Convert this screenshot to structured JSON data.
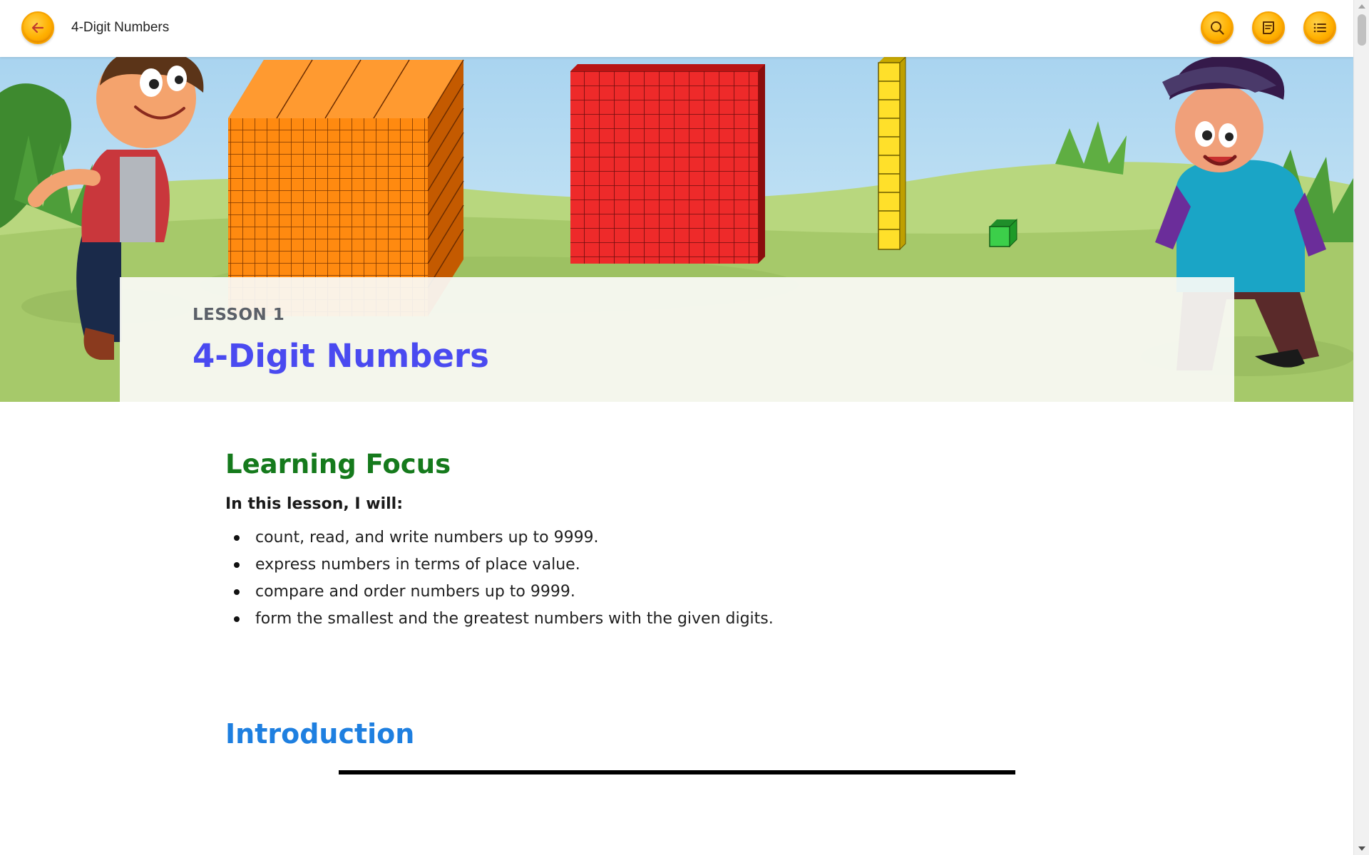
{
  "header": {
    "title": "4-Digit Numbers",
    "back_icon": "arrow-left-icon",
    "search_icon": "search-icon",
    "notes_icon": "notes-icon",
    "toc_icon": "list-icon",
    "accent_color": "#ffb000"
  },
  "hero": {
    "lesson_label": "LESSON 1",
    "lesson_title": "4-Digit Numbers",
    "title_color": "#4a4af0"
  },
  "learning_focus": {
    "heading": "Learning Focus",
    "intro": "In this lesson, I will:",
    "items": [
      "count, read, and write numbers up to 9999.",
      "express numbers in terms of place value.",
      "compare and order numbers up to 9999.",
      "form the smallest and the greatest numbers with the given digits."
    ],
    "heading_color": "#157a1c"
  },
  "introduction": {
    "heading": "Introduction",
    "heading_color": "#1e7fe0"
  }
}
